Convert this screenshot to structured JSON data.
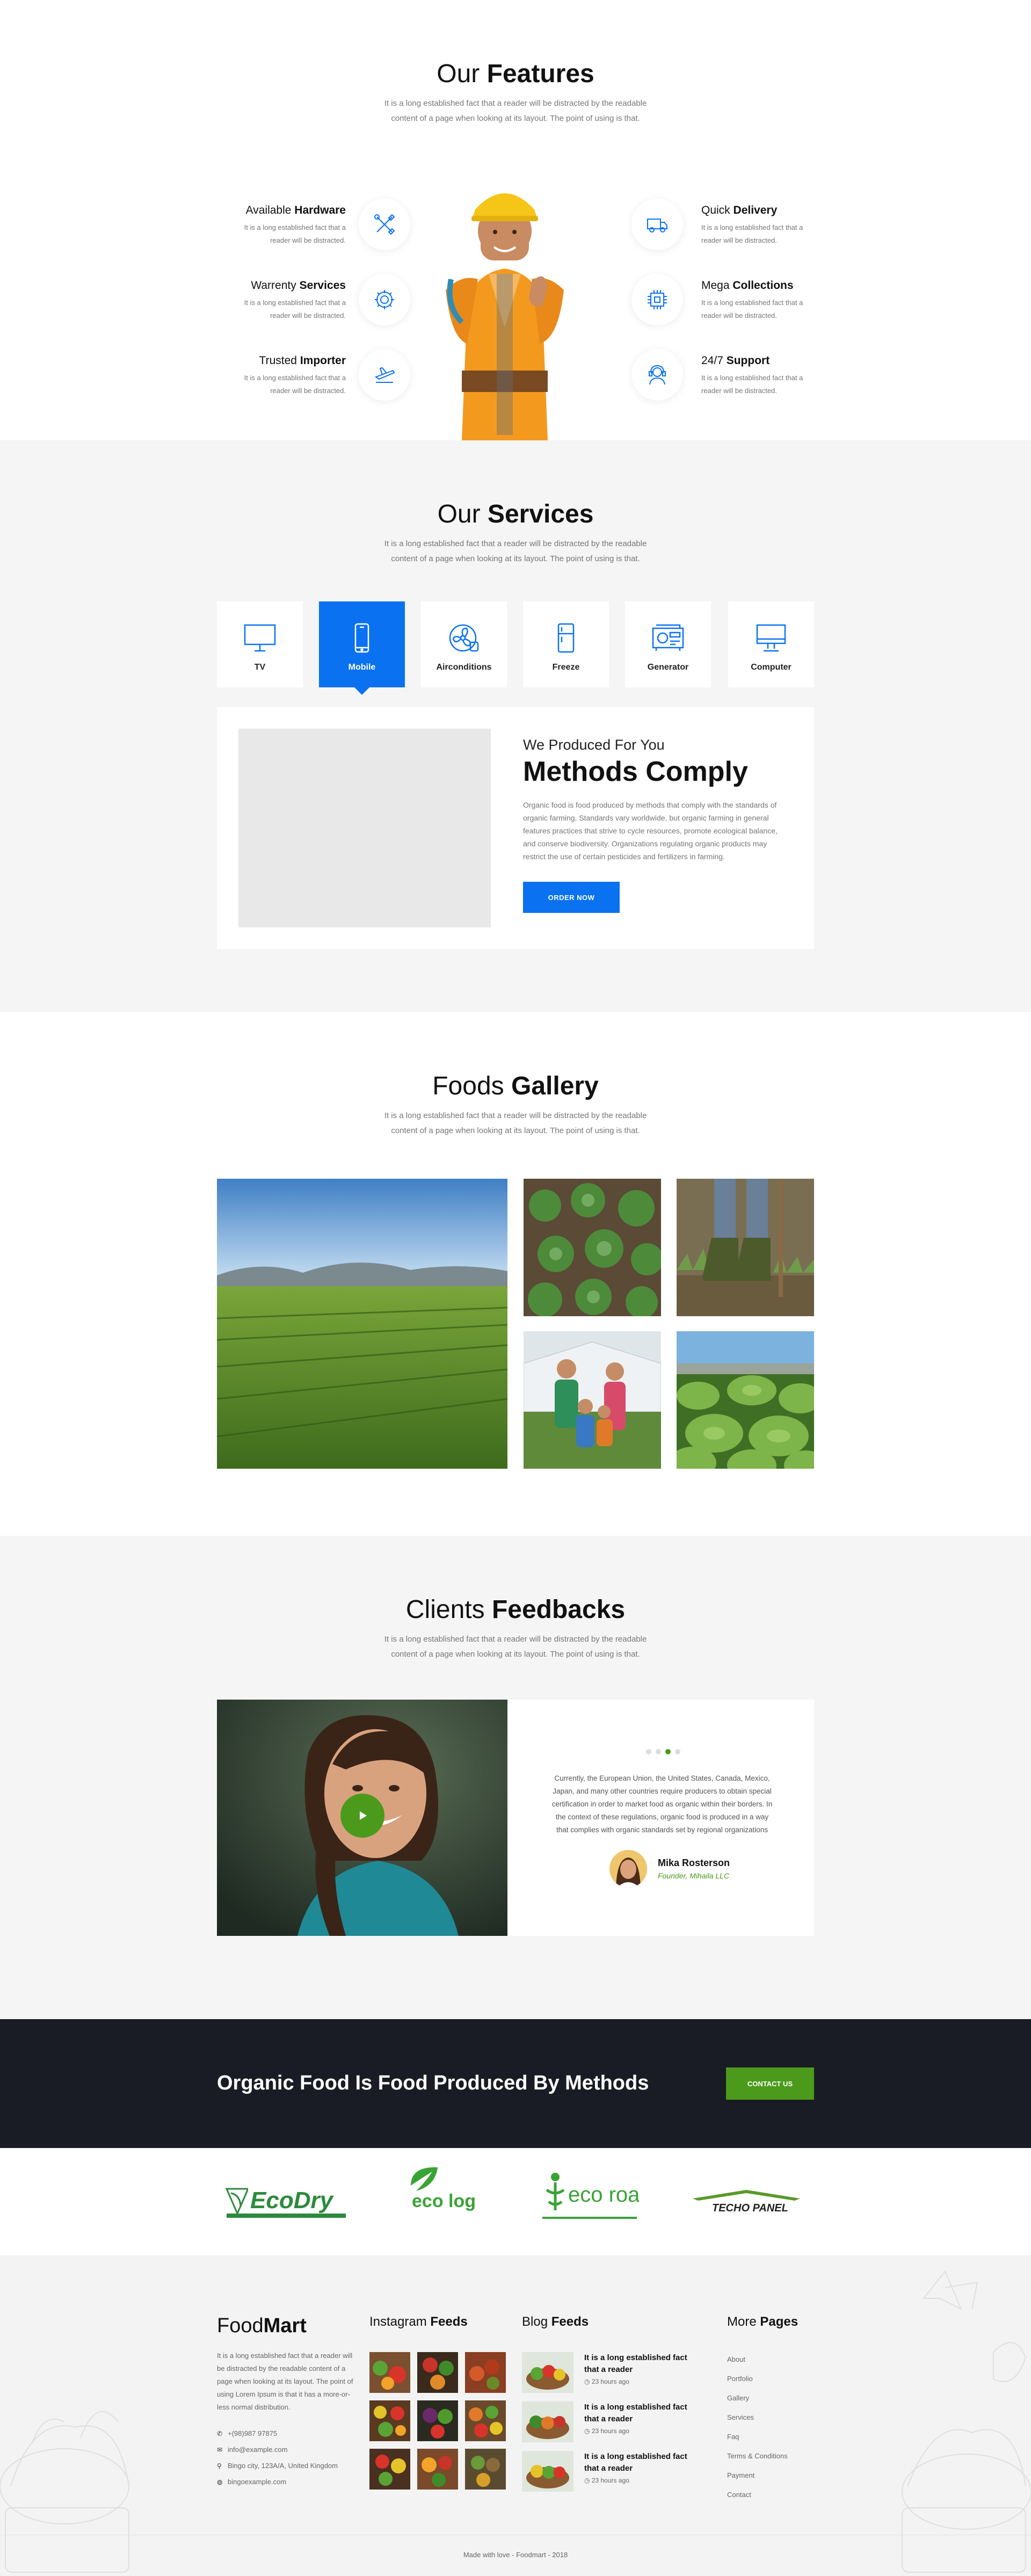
{
  "features": {
    "title_light": "Our",
    "title_bold": "Features",
    "subtitle": "It is a long established fact that a reader will be distracted by the readable content of a page when looking at its layout. The point of using is that.",
    "left": [
      {
        "light": "Available",
        "bold": "Hardware",
        "desc": "It is a long established fact that a reader will be distracted.",
        "icon": "tools-icon"
      },
      {
        "light": "Warrenty",
        "bold": "Services",
        "desc": "It is a long established fact that a reader will be distracted.",
        "icon": "gear-icon"
      },
      {
        "light": "Trusted",
        "bold": "Importer",
        "desc": "It is a long established fact that a reader will be distracted.",
        "icon": "airplane-icon"
      }
    ],
    "right": [
      {
        "light": "Quick",
        "bold": "Delivery",
        "desc": "It is a long established fact that a reader will be distracted.",
        "icon": "truck-icon"
      },
      {
        "light": "Mega",
        "bold": "Collections",
        "desc": "It is a long established fact that a reader will be distracted.",
        "icon": "chip-icon"
      },
      {
        "light": "24/7",
        "bold": "Support",
        "desc": "It is a long established fact that a reader will be distracted.",
        "icon": "headset-icon"
      }
    ]
  },
  "services": {
    "title_light": "Our",
    "title_bold": "Services",
    "subtitle": "It is a long established fact that a reader will be distracted by the readable content of a page when looking at its layout. The point of using is that.",
    "tabs": [
      {
        "label": "TV",
        "icon": "tv-icon"
      },
      {
        "label": "Mobile",
        "icon": "mobile-icon",
        "active": true
      },
      {
        "label": "Airconditions",
        "icon": "fan-icon"
      },
      {
        "label": "Freeze",
        "icon": "fridge-icon"
      },
      {
        "label": "Generator",
        "icon": "generator-icon"
      },
      {
        "label": "Computer",
        "icon": "computer-icon"
      }
    ],
    "panel": {
      "kicker": "We Produced For You",
      "heading": "Methods Comply",
      "body": "Organic food is food produced by methods that comply with the standards of organic farming. Standards vary worldwide, but organic farming in general features practices that strive to cycle resources, promote ecological balance, and conserve biodiversity. Organizations regulating organic products may restrict the use of certain pesticides and fertilizers in farming.",
      "button": "ORDER NOW"
    }
  },
  "gallery": {
    "title_light": "Foods",
    "title_bold": "Gallery",
    "subtitle": "It is a long established fact that a reader will be distracted by the readable content of a page when looking at its layout. The point of using is that."
  },
  "feedbacks": {
    "title_light": "Clients",
    "title_bold": "Feedbacks",
    "subtitle": "It is a long established fact that a reader will be distracted by the readable content of a page when looking at its layout. The point of using is that.",
    "quote": "Currently, the European Union, the United States, Canada, Mexico, Japan, and many other countries require producers to obtain special certification in order to market food as organic within their borders. In the context of these regulations, organic food is produced in a way that complies with organic standards set by regional organizations",
    "name": "Mika Rosterson",
    "role": "Founder, Mihaila LLC",
    "dots": 4,
    "active_dot": 3
  },
  "cta": {
    "text": "Organic Food Is Food Produced By Methods",
    "button": "CONTACT US"
  },
  "logos": [
    "EcoDry",
    "eco logic",
    "eco road",
    "TECHO PANEL"
  ],
  "footer": {
    "brand_light": "Food",
    "brand_bold": "Mart",
    "about": "It is a long established fact that a reader will be distracted by the readable content of a page when looking at its layout. The point of using Lorem Ipsum is that it has a more-or-less normal distribution.",
    "contacts": [
      {
        "icon": "phone-icon",
        "text": "+(98)987 97875"
      },
      {
        "icon": "mail-icon",
        "text": "info@example.com"
      },
      {
        "icon": "pin-icon",
        "text": "Bingo city, 123A/A, United Kingdom"
      },
      {
        "icon": "globe-icon",
        "text": "bingoexample.com"
      }
    ],
    "insta_light": "Instagram",
    "insta_bold": "Feeds",
    "blog_light": "Blog",
    "blog_bold": "Feeds",
    "blog": [
      {
        "title": "It is a long established fact that a reader",
        "time": "23 hours ago"
      },
      {
        "title": "It is a long established fact that a reader",
        "time": "23 hours ago"
      },
      {
        "title": "It is a long established fact that a reader",
        "time": "23 hours ago"
      }
    ],
    "pages_light": "More",
    "pages_bold": "Pages",
    "pages": [
      "About",
      "Portfolio",
      "Gallery",
      "Services",
      "Faq",
      "Terms & Conditions",
      "Payment",
      "Contact"
    ],
    "copyright": "Made with love - Foodmart - 2018"
  },
  "colors": {
    "accent_blue": "#0a72f0",
    "accent_green": "#4b9a1c",
    "dark": "#191c24"
  }
}
